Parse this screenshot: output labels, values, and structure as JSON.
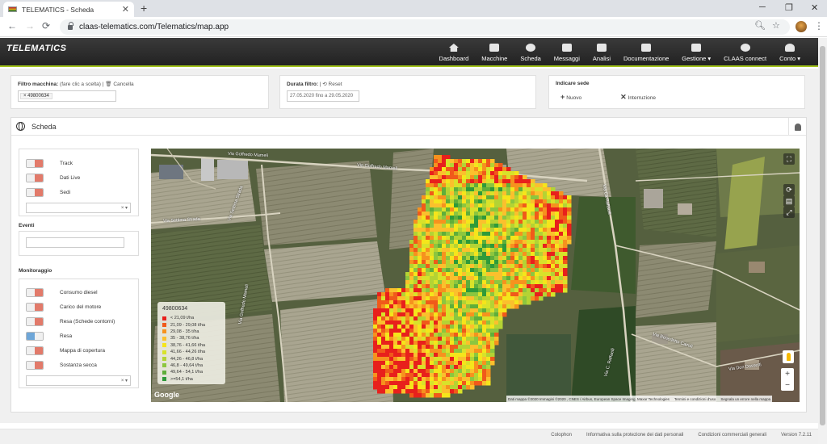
{
  "browser": {
    "tab_title": "TELEMATICS - Scheda",
    "tab_close": "✕",
    "new_tab": "+",
    "url": "claas-telematics.com/Telematics/map.app",
    "win_min": "─",
    "win_max": "❐",
    "win_close": "✕"
  },
  "app": {
    "logo": "TELEMATICS",
    "nav": [
      {
        "label": "Dashboard",
        "icon": "home-icon"
      },
      {
        "label": "Macchine",
        "icon": "tractor-icon"
      },
      {
        "label": "Scheda",
        "icon": "globe-icon"
      },
      {
        "label": "Messaggi",
        "icon": "messages-icon"
      },
      {
        "label": "Analisi",
        "icon": "analysis-icon"
      },
      {
        "label": "Documentazione",
        "icon": "documents-icon"
      },
      {
        "label": "Gestione ▾",
        "icon": "management-icon"
      },
      {
        "label": "CLAAS connect",
        "icon": "connect-icon"
      },
      {
        "label": "Conto ▾",
        "icon": "user-icon"
      }
    ]
  },
  "filters": {
    "machine_label": "Filtro macchina:",
    "machine_hint": "(fare clic a scelta) |",
    "machine_clear": "🗑 Cancella",
    "machine_chip": "× 49800634",
    "duration_label": "Durata filtro:",
    "duration_reset": "| ⟲ Reset",
    "duration_value": "27.05.2020 fino a 29.05.2020",
    "site_label": "Indicare sede",
    "site_new": "Nuovo",
    "site_interrupt": "Interruzione"
  },
  "panel": {
    "title": "Scheda",
    "layers": [
      "Track",
      "Dati Live",
      "Sedi"
    ],
    "events_label": "Eventi",
    "monitoring_label": "Monitoraggio",
    "monitoring": [
      {
        "label": "Consumo diesel",
        "on": false
      },
      {
        "label": "Carico del motore",
        "on": false
      },
      {
        "label": "Resa (Schede contorni)",
        "on": false
      },
      {
        "label": "Resa",
        "on": true
      },
      {
        "label": "Mappa di copertura",
        "on": false
      },
      {
        "label": "Sostanza secca",
        "on": false
      }
    ]
  },
  "map": {
    "roads": {
      "r1": "Via Goffredo Mameli",
      "r2": "Via Goffredo Mameli",
      "r3": "Via Settima Strada",
      "r4": "Via Settima Strada",
      "r5": "Via Goffredo Mameli",
      "r6": "Via Cà Raffaelli",
      "r7": "Via Benedetto Cairoli",
      "r8": "Via Don Dossetti",
      "r9": "Via C. Raffaelli"
    },
    "google": "Google",
    "attribution": [
      "Dati mappa ©2020 Immagini ©2020 , CNES / Airbus, European Space Imaging, Maxar Technologies",
      "Termini e condizioni d'uso",
      "Segnala un errore nella mappa"
    ],
    "legend": {
      "title": "49800634",
      "items": [
        {
          "label": "< 21,09  t/ha",
          "color": "#e8201c"
        },
        {
          "label": "21,09 - 29,08  t/ha",
          "color": "#f05a1a"
        },
        {
          "label": "29,08 - 35  t/ha",
          "color": "#f6921e"
        },
        {
          "label": "35 - 38,76  t/ha",
          "color": "#fbc02d"
        },
        {
          "label": "38,76 - 41,66  t/ha",
          "color": "#f5e51b"
        },
        {
          "label": "41,66 - 44,26  t/ha",
          "color": "#d8e22a"
        },
        {
          "label": "44,26 - 46,8  t/ha",
          "color": "#b4d334"
        },
        {
          "label": "46,8 - 49,64  t/ha",
          "color": "#8cc63f"
        },
        {
          "label": "49,64 - 54,1  t/ha",
          "color": "#5fae3a"
        },
        {
          "label": ">=54,1  t/ha",
          "color": "#2e9a3a"
        }
      ]
    }
  },
  "footer": {
    "links": [
      "Colophon",
      "Informativa sulla protezione dei dati personali",
      "Condizioni commerciali generali",
      "Version 7.2.11"
    ]
  }
}
